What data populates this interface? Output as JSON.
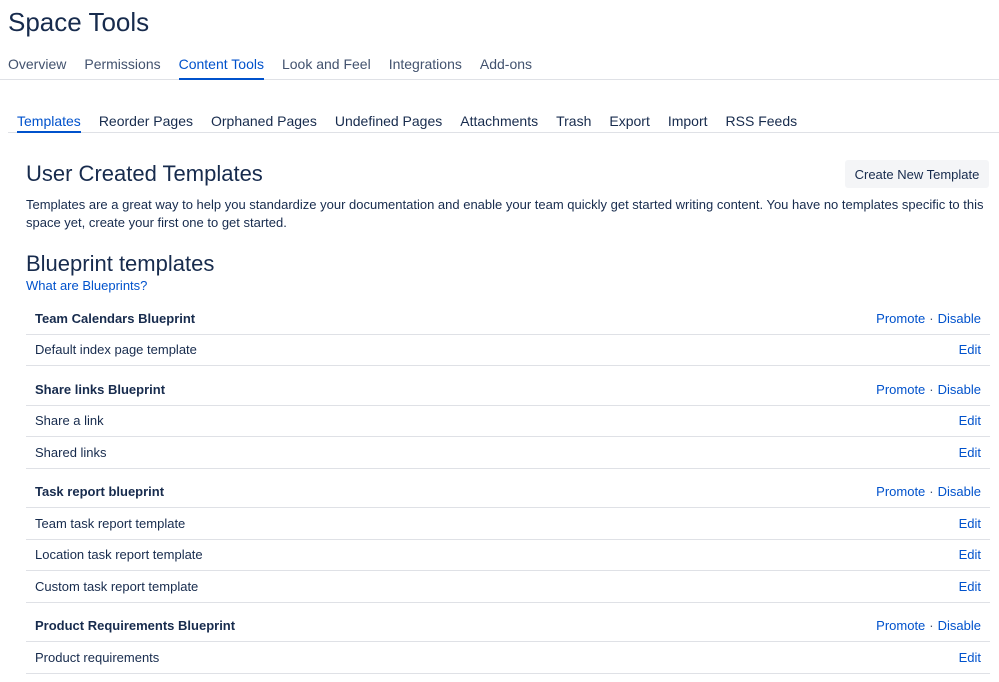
{
  "page_title": "Space Tools",
  "top_tabs": [
    {
      "label": "Overview"
    },
    {
      "label": "Permissions"
    },
    {
      "label": "Content Tools"
    },
    {
      "label": "Look and Feel"
    },
    {
      "label": "Integrations"
    },
    {
      "label": "Add-ons"
    }
  ],
  "sub_tabs": [
    {
      "label": "Templates"
    },
    {
      "label": "Reorder Pages"
    },
    {
      "label": "Orphaned Pages"
    },
    {
      "label": "Undefined Pages"
    },
    {
      "label": "Attachments"
    },
    {
      "label": "Trash"
    },
    {
      "label": "Export"
    },
    {
      "label": "Import"
    },
    {
      "label": "RSS Feeds"
    }
  ],
  "user_templates": {
    "title": "User Created Templates",
    "create_button": "Create New Template",
    "description": "Templates are a great way to help you standardize your documentation and enable your team quickly get started writing content. You have no templates specific to this space yet, create your first one to get started."
  },
  "blueprints": {
    "title": "Blueprint templates",
    "help_link": "What are Blueprints?",
    "promote_label": "Promote",
    "disable_label": "Disable",
    "separator": "·",
    "edit_label": "Edit",
    "groups": [
      {
        "name": "Team Calendars Blueprint",
        "items": [
          "Default index page template"
        ]
      },
      {
        "name": "Share links Blueprint",
        "items": [
          "Share a link",
          "Shared links"
        ]
      },
      {
        "name": "Task report blueprint",
        "items": [
          "Team task report template",
          "Location task report template",
          "Custom task report template"
        ]
      },
      {
        "name": "Product Requirements Blueprint",
        "items": [
          "Product requirements"
        ]
      }
    ]
  },
  "colors": {
    "link": "#0052cc",
    "text": "#172b4d",
    "border": "#dfe1e6"
  }
}
